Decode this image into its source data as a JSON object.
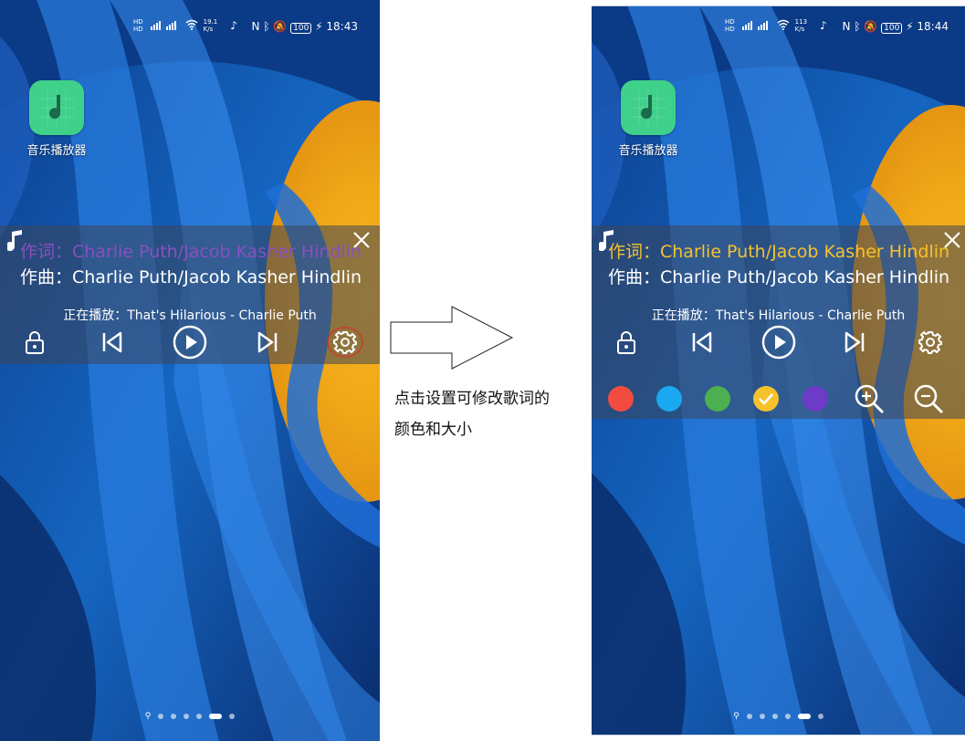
{
  "left": {
    "statusbar": {
      "time": "18:43",
      "speed": "19.1",
      "speed_unit": "K/s",
      "battery": "100"
    },
    "app": {
      "label": "音乐播放器"
    },
    "lyrics": {
      "line1": "作词：Charlie Puth/Jacob Kasher Hindlin",
      "line2": "作曲：Charlie Puth/Jacob Kasher Hindlin",
      "line1_color": "#8a4fc0",
      "now_playing": "正在播放：That's Hilarious - Charlie Puth"
    }
  },
  "right": {
    "statusbar": {
      "time": "18:44",
      "speed": "113",
      "speed_unit": "K/s",
      "battery": "100"
    },
    "app": {
      "label": "音乐播放器"
    },
    "lyrics": {
      "line1": "作词：Charlie Puth/Jacob Kasher Hindlin",
      "line2": "作曲：Charlie Puth/Jacob Kasher Hindlin",
      "line1_color": "#f6c22c",
      "now_playing": "正在播放：That's Hilarious - Charlie Puth"
    },
    "color_options": [
      "#f24b3f",
      "#1aa8f0",
      "#4caf50",
      "#f6c22c",
      "#6d3bc7"
    ],
    "selected_color": "#f6c22c"
  },
  "caption": {
    "line1": "点击设置可修改歌词的",
    "line2": "颜色和大小"
  },
  "icons": {
    "lock": "lock-icon",
    "prev": "skip-previous-icon",
    "play": "play-circle-icon",
    "next": "skip-next-icon",
    "settings": "gear-icon",
    "zoom_in": "zoom-in-icon",
    "zoom_out": "zoom-out-icon",
    "note": "music-note-icon",
    "close": "close-icon"
  }
}
